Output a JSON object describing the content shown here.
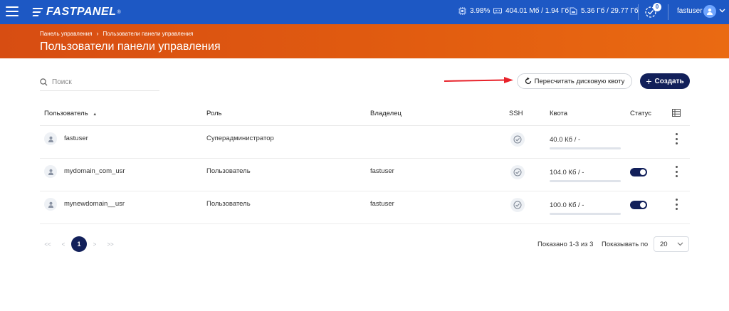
{
  "topbar": {
    "logo_text": "FASTPANEL",
    "logo_mark": "®",
    "cpu": "3.98%",
    "ram": "404.01 Мб / 1.94 Гб",
    "disk": "5.36 Гб / 29.77 Гб",
    "notifications_count": "0",
    "username": "fastuser",
    "icons": [
      "menu-icon",
      "cpu-icon",
      "ram-icon",
      "disk-icon",
      "notification-icon",
      "user-avatar-icon",
      "chevron-down-icon"
    ]
  },
  "header": {
    "breadcrumbs": [
      "Панель управления",
      "Пользователи панели управления"
    ],
    "breadcrumb_separator": "›",
    "title": "Пользователи панели управления",
    "colors": {
      "from": "#d74d12",
      "to": "#ea6a12"
    }
  },
  "toolbar": {
    "search_placeholder": "Поиск",
    "recalc_label": "Пересчитать дисковую квоту",
    "create_label": "Создать",
    "create_plus": "+"
  },
  "table": {
    "columns": {
      "user": "Пользователь",
      "role": "Роль",
      "owner": "Владелец",
      "ssh": "SSH",
      "quota": "Квота",
      "status": "Статус"
    },
    "sort_indicator": "▲",
    "rows": [
      {
        "name": "fastuser",
        "role": "Суперадминистратор",
        "owner": "",
        "ssh": true,
        "quota": "40.0 Кб / -",
        "status_toggle": false
      },
      {
        "name": "mydomain_com_usr",
        "role": "Пользователь",
        "owner": "fastuser",
        "ssh": true,
        "quota": "104.0 Кб / -",
        "status_toggle": true
      },
      {
        "name": "mynewdomain__usr",
        "role": "Пользователь",
        "owner": "fastuser",
        "ssh": true,
        "quota": "100.0 Кб / -",
        "status_toggle": true
      }
    ]
  },
  "pagination": {
    "first": "<<",
    "prev": "<",
    "current": "1",
    "next": ">",
    "last": ">>",
    "shown_text": "Показано 1-3 из 3",
    "per_page_label": "Показывать по",
    "per_page_value": "20"
  },
  "colors": {
    "topbar": "#1d58c4",
    "primary_dark": "#12205a",
    "accent_orange": "#e25d10",
    "arrow_red": "#e8222a"
  }
}
